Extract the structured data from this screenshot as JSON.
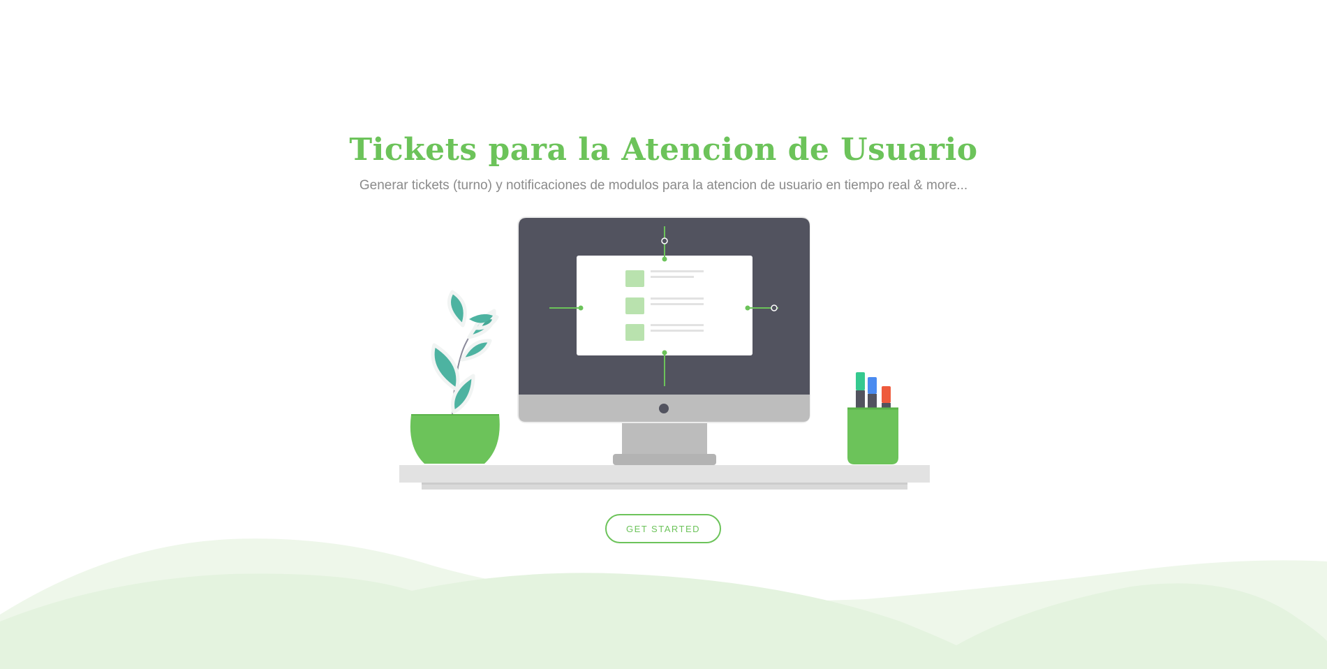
{
  "hero": {
    "title": "Tickets para la Atencion de Usuario",
    "subtitle": "Generar tickets (turno) y notificaciones de modulos para la atencion de usuario en tiempo real & more...",
    "cta_label": "GET STARTED"
  },
  "colors": {
    "accent": "#6cc35a",
    "monitor_screen": "#52535f",
    "monitor_body": "#bcbcbc",
    "plant_leaf": "#4db3a1",
    "wave_light": "#eef7ea",
    "wave_mid": "#e4f3df",
    "marker_teal": "#35c98f",
    "marker_blue": "#4a8bf0",
    "marker_red": "#ee5a3c"
  },
  "icons": {
    "plant": "potted-plant-icon",
    "monitor": "desktop-monitor-icon",
    "pens": "pen-holder-icon"
  }
}
